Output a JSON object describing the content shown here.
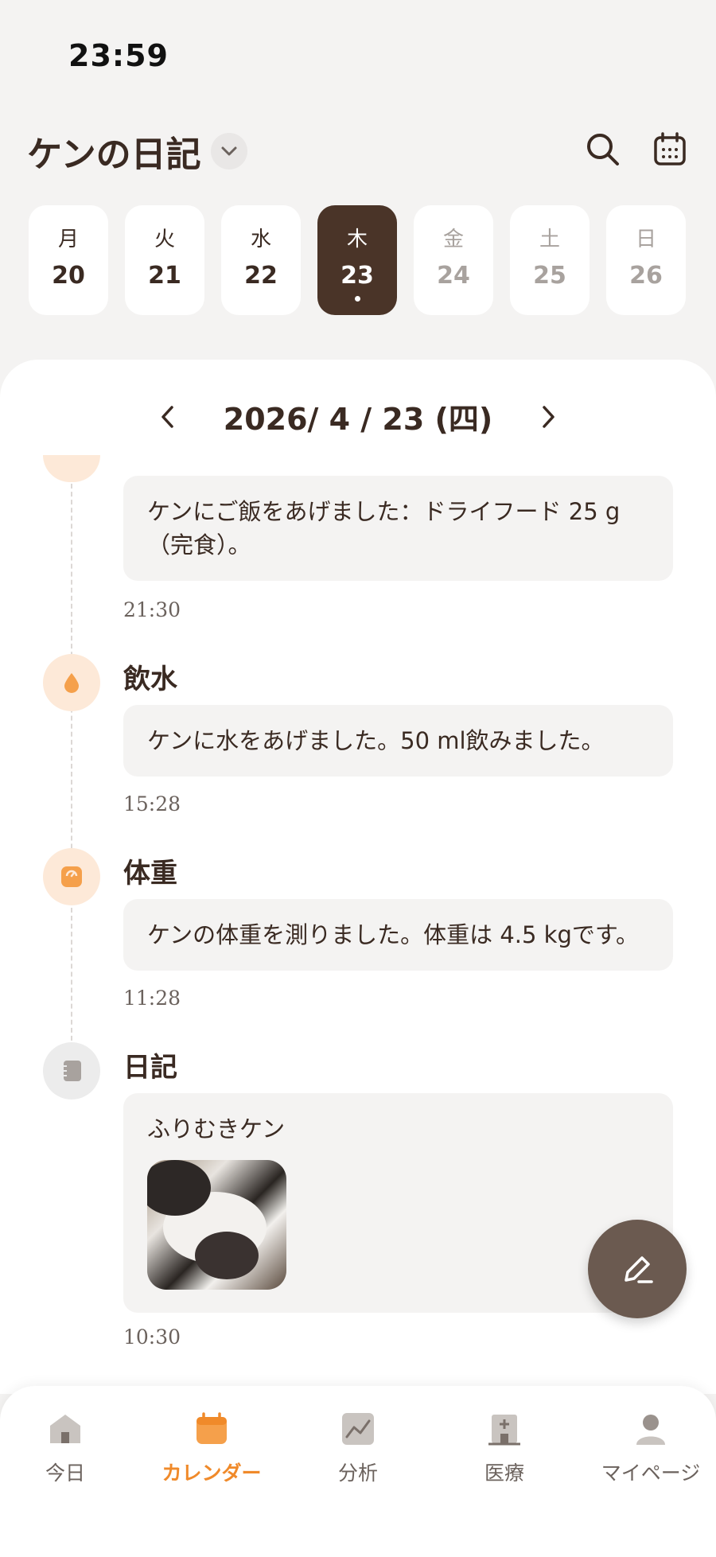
{
  "status": {
    "time": "23:59"
  },
  "header": {
    "title": "ケンの日記",
    "dropdown_icon": "chevron-down-icon",
    "search_icon": "search-icon",
    "calendar_icon": "calendar-icon"
  },
  "week": [
    {
      "dow": "月",
      "num": "20",
      "state": "past"
    },
    {
      "dow": "火",
      "num": "21",
      "state": "past"
    },
    {
      "dow": "水",
      "num": "22",
      "state": "past"
    },
    {
      "dow": "木",
      "num": "23",
      "state": "active"
    },
    {
      "dow": "金",
      "num": "24",
      "state": "future"
    },
    {
      "dow": "土",
      "num": "25",
      "state": "future"
    },
    {
      "dow": "日",
      "num": "26",
      "state": "future"
    }
  ],
  "date_nav": {
    "date": "2026/ 4 / 23 (四)"
  },
  "entries": [
    {
      "text": "ケンにご飯をあげました：ドライフード 25 g（完食）。",
      "time": "21:30"
    },
    {
      "title": "飲水",
      "text": "ケンに水をあげました。50 ml飲みました。",
      "time": "15:28",
      "icon": "water-drop-icon"
    },
    {
      "title": "体重",
      "text": "ケンの体重を測りました。体重は 4.5 kgです。",
      "time": "11:28",
      "icon": "scale-icon"
    },
    {
      "title": "日記",
      "text": "ふりむきケン",
      "time": "10:30",
      "icon": "notebook-icon"
    }
  ],
  "tabs": [
    {
      "label": "今日",
      "icon": "home-icon"
    },
    {
      "label": "カレンダー",
      "icon": "calendar-icon",
      "active": true
    },
    {
      "label": "分析",
      "icon": "chart-icon"
    },
    {
      "label": "医療",
      "icon": "hospital-icon"
    },
    {
      "label": "マイページ",
      "icon": "person-icon"
    }
  ],
  "colors": {
    "accent": "#f08a2a",
    "brown": "#4a3428",
    "fab": "#6b5a50"
  }
}
